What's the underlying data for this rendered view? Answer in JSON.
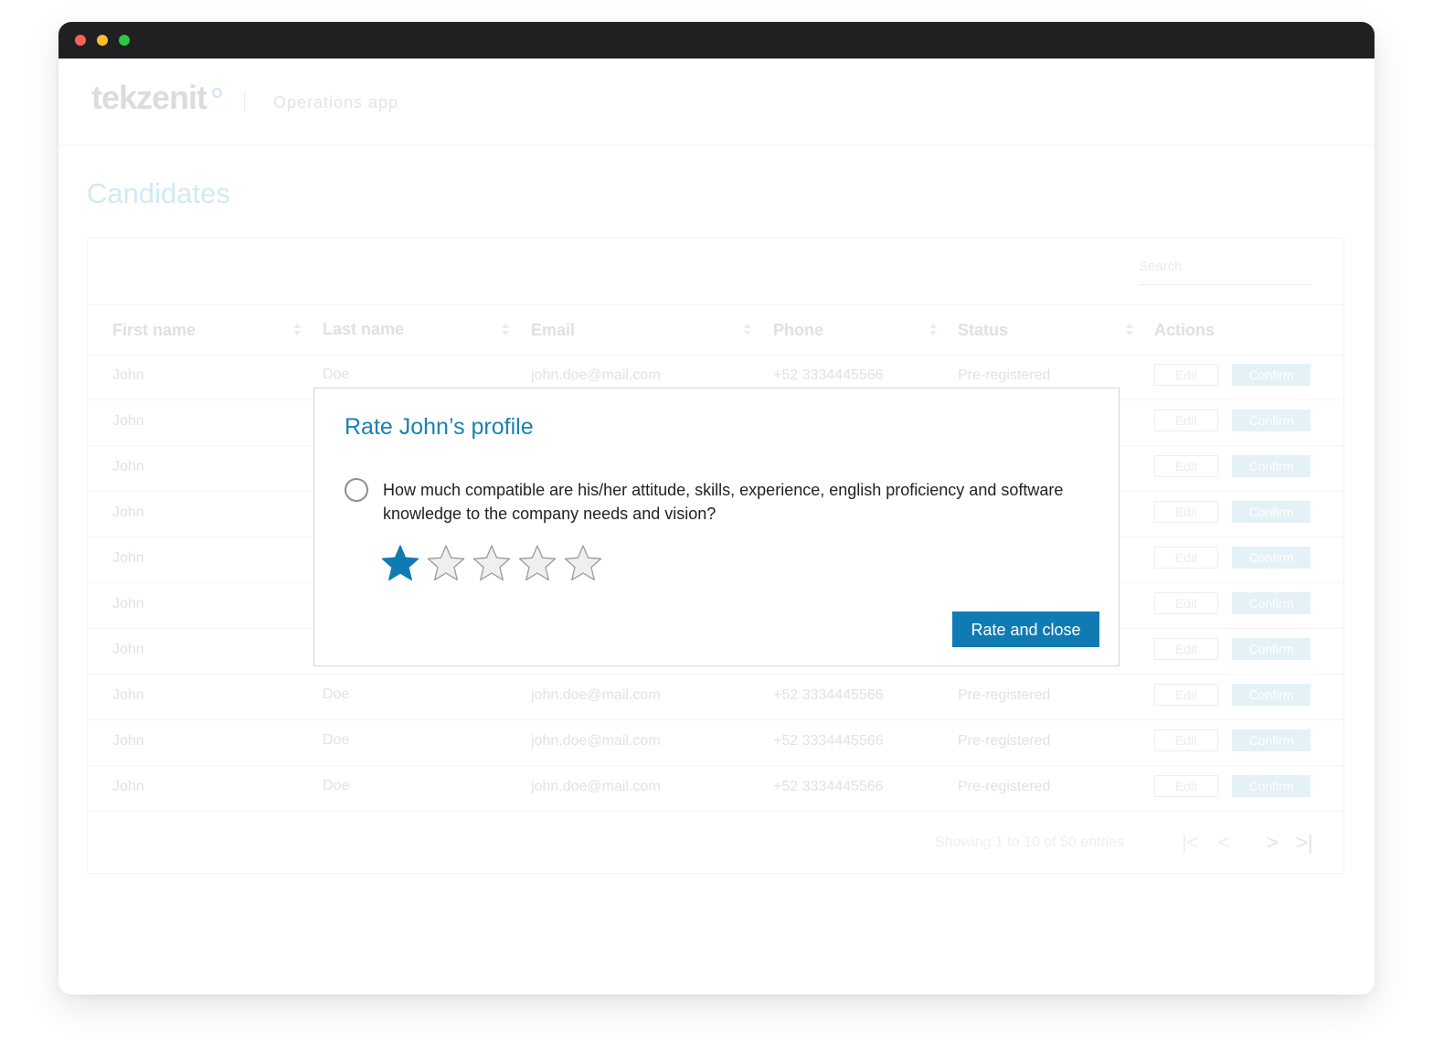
{
  "header": {
    "logo": "tekzenit",
    "app_name": "Operations app"
  },
  "page": {
    "title": "Candidates"
  },
  "table": {
    "search_placeholder": "Search",
    "columns": [
      "First name",
      "Last name",
      "Email",
      "Phone",
      "Status",
      "Actions"
    ],
    "rows": [
      {
        "first": "John",
        "last": "Doe",
        "email": "john.doe@mail.com",
        "phone": "+52 3334445566",
        "status": "Pre-registered"
      },
      {
        "first": "John",
        "last": "",
        "email": "",
        "phone": "",
        "status": ""
      },
      {
        "first": "John",
        "last": "",
        "email": "",
        "phone": "",
        "status": ""
      },
      {
        "first": "John",
        "last": "",
        "email": "",
        "phone": "",
        "status": ""
      },
      {
        "first": "John",
        "last": "",
        "email": "",
        "phone": "",
        "status": ""
      },
      {
        "first": "John",
        "last": "",
        "email": "",
        "phone": "",
        "status": ""
      },
      {
        "first": "John",
        "last": "",
        "email": "",
        "phone": "",
        "status": ""
      },
      {
        "first": "John",
        "last": "Doe",
        "email": "john.doe@mail.com",
        "phone": "+52 3334445566",
        "status": "Pre-registered"
      },
      {
        "first": "John",
        "last": "Doe",
        "email": "john.doe@mail.com",
        "phone": "+52 3334445566",
        "status": "Pre-registered"
      },
      {
        "first": "John",
        "last": "Doe",
        "email": "john.doe@mail.com",
        "phone": "+52 3334445566",
        "status": "Pre-registered"
      }
    ],
    "edit_label": "Edit",
    "confirm_label": "Confirm",
    "pagination_info": "Showing 1 to 10 of 50 entries",
    "pager_first": "|<",
    "pager_prev": "<",
    "pager_next": ">",
    "pager_last": ">|"
  },
  "modal": {
    "title": "Rate John’s profile",
    "question": "How much compatible are his/her attitude, skills, experience, english proficiency and software knowledge to the company needs and vision?",
    "rating": 1,
    "rating_max": 5,
    "submit_label": "Rate and close"
  },
  "colors": {
    "accent": "#107bb2",
    "title_blue": "#1a82b3",
    "star_filled": "#107bb2",
    "star_empty": "#efefef"
  },
  "icons": {
    "radio": "radio-unchecked-icon",
    "star_filled": "star-filled-icon",
    "star_empty": "star-empty-icon"
  }
}
